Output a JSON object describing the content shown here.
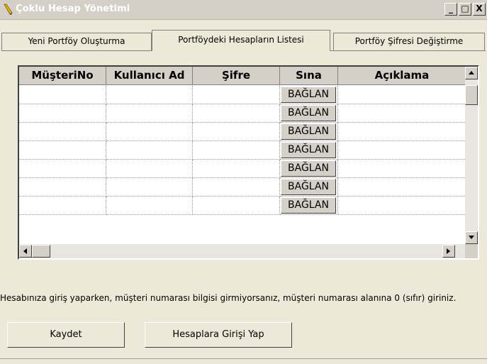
{
  "window": {
    "title": "Çoklu Hesap Yönetimi",
    "min_glyph": "_",
    "max_glyph": "□",
    "close_glyph": "X"
  },
  "tabs": [
    {
      "label": "Yeni Portföy Oluşturma"
    },
    {
      "label": "Portföydeki Hesapların Listesi"
    },
    {
      "label": "Portföy Şifresi Değiştirme"
    }
  ],
  "grid": {
    "columns": [
      "MüşteriNo",
      "Kullanıcı Ad",
      "Şifre",
      "Sına",
      "Açıklama"
    ],
    "rows": [
      {
        "musteri_no": "",
        "kullanici_ad": "",
        "sifre": "",
        "sina": "BAĞLAN",
        "aciklama": ""
      },
      {
        "musteri_no": "",
        "kullanici_ad": "",
        "sifre": "",
        "sina": "BAĞLAN",
        "aciklama": ""
      },
      {
        "musteri_no": "",
        "kullanici_ad": "",
        "sifre": "",
        "sina": "BAĞLAN",
        "aciklama": ""
      },
      {
        "musteri_no": "",
        "kullanici_ad": "",
        "sifre": "",
        "sina": "BAĞLAN",
        "aciklama": ""
      },
      {
        "musteri_no": "",
        "kullanici_ad": "",
        "sifre": "",
        "sina": "BAĞLAN",
        "aciklama": ""
      },
      {
        "musteri_no": "",
        "kullanici_ad": "",
        "sifre": "",
        "sina": "BAĞLAN",
        "aciklama": ""
      },
      {
        "musteri_no": "",
        "kullanici_ad": "",
        "sifre": "",
        "sina": "BAĞLAN",
        "aciklama": ""
      }
    ]
  },
  "note": "Hesabınıza giriş yaparken, müşteri numarası bilgisi girmiyorsanız, müşteri numarası alanına 0 (sıfır) giriniz.",
  "buttons": {
    "save": "Kaydet",
    "login": "Hesaplara Girişi Yap"
  },
  "icons": {
    "window_icon": "pencil-icon",
    "scroll_up": "arrow-up-icon",
    "scroll_down": "arrow-down-icon",
    "scroll_left": "arrow-left-icon",
    "scroll_right": "arrow-right-icon"
  }
}
